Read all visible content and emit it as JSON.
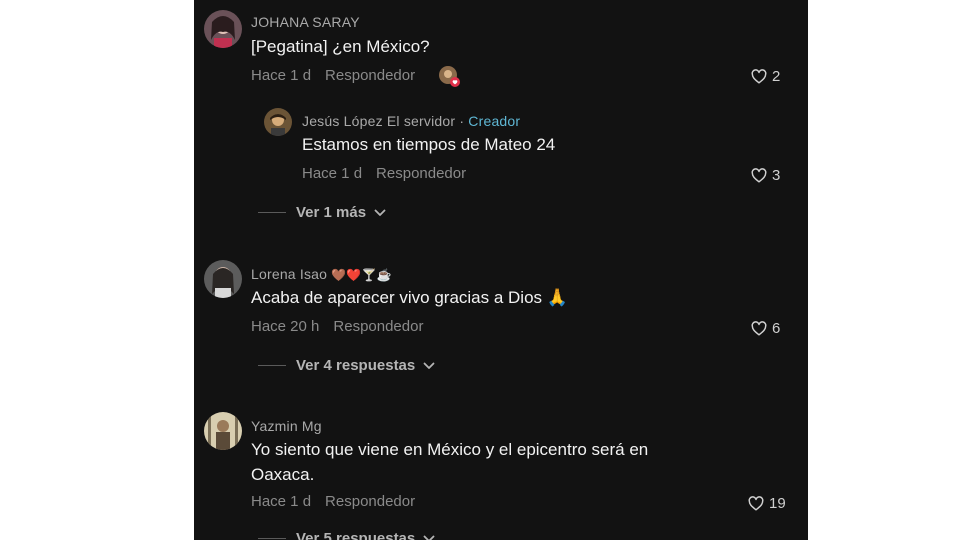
{
  "comments": [
    {
      "username": "JOHANA SARAY",
      "text": "[Pegatina] ¿en México?",
      "time": "Hace 1 d",
      "reply_label": "Respondedor",
      "likes": "2",
      "replies": [
        {
          "username": "Jesús López El servidor",
          "separator": " · ",
          "badge": "Creador",
          "text": "Estamos en tiempos de Mateo 24",
          "time": "Hace 1 d",
          "reply_label": "Respondedor",
          "likes": "3"
        }
      ],
      "more_label": "Ver 1 más"
    },
    {
      "username": "Lorena Isao",
      "emojis": "🤎❤️🍸☕",
      "text": "Acaba de aparecer vivo gracias a Dios 🙏",
      "time": "Hace 20 h",
      "reply_label": "Respondedor",
      "likes": "6",
      "more_label": "Ver 4 respuestas"
    },
    {
      "username": "Yazmin Mg",
      "text": "Yo siento que viene en México y el epicentro será en Oaxaca.",
      "time": "Hace 1 d",
      "reply_label": "Respondedor",
      "likes": "19",
      "more_label": "Ver 5 respuestas"
    }
  ],
  "colors": {
    "background": "#121212",
    "username": "#a9a9a9",
    "creator_badge": "#5fb7d4",
    "text": "#f2f2f2",
    "meta": "#8a8a8a"
  },
  "icons": {
    "like": "heart-outline-icon",
    "expand": "chevron-down-icon"
  }
}
